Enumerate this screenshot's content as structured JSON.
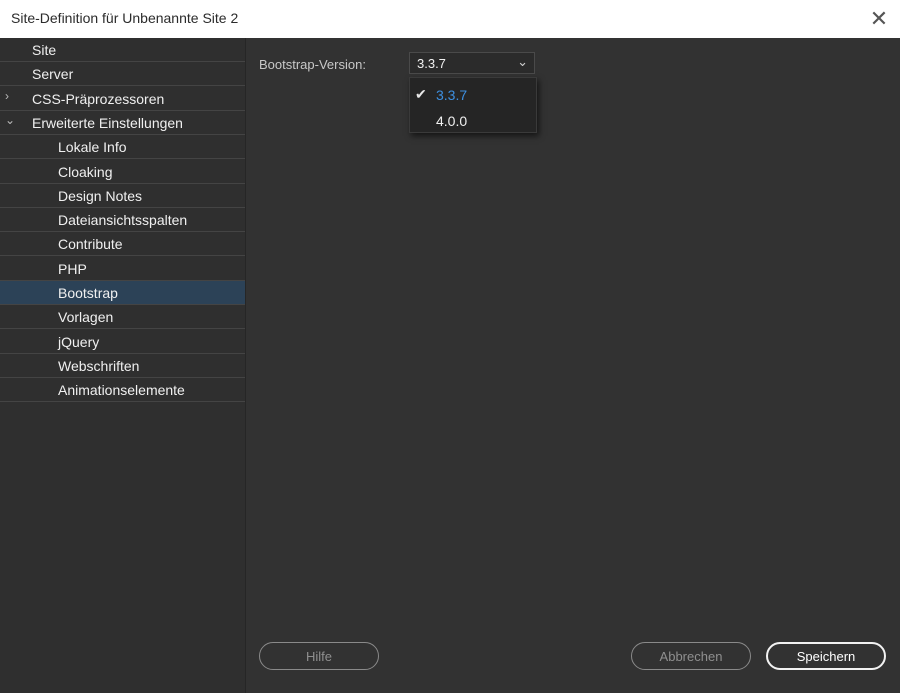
{
  "window": {
    "title": "Site-Definition für Unbenannte Site 2",
    "close_icon": "close-icon"
  },
  "sidebar": {
    "items": [
      {
        "label": "Site",
        "indent": 0,
        "chevron": ""
      },
      {
        "label": "Server",
        "indent": 0,
        "chevron": ""
      },
      {
        "label": "CSS-Präprozessoren",
        "indent": 0,
        "chevron": "›"
      },
      {
        "label": "Erweiterte Einstellungen",
        "indent": 0,
        "chevron": "⌄"
      },
      {
        "label": "Lokale Info",
        "indent": 1,
        "chevron": ""
      },
      {
        "label": "Cloaking",
        "indent": 1,
        "chevron": ""
      },
      {
        "label": "Design Notes",
        "indent": 1,
        "chevron": ""
      },
      {
        "label": "Dateiansichtsspalten",
        "indent": 1,
        "chevron": ""
      },
      {
        "label": "Contribute",
        "indent": 1,
        "chevron": ""
      },
      {
        "label": "PHP",
        "indent": 1,
        "chevron": ""
      },
      {
        "label": "Bootstrap",
        "indent": 1,
        "chevron": "",
        "selected": true
      },
      {
        "label": "Vorlagen",
        "indent": 1,
        "chevron": ""
      },
      {
        "label": "jQuery",
        "indent": 1,
        "chevron": ""
      },
      {
        "label": "Webschriften",
        "indent": 1,
        "chevron": ""
      },
      {
        "label": "Animationselemente",
        "indent": 1,
        "chevron": ""
      }
    ]
  },
  "main": {
    "bootstrap_version_label": "Bootstrap-Version:",
    "select": {
      "value": "3.3.7",
      "arrow_icon": "chevron-down-icon"
    },
    "dropdown": {
      "options": [
        {
          "label": "3.3.7",
          "checked": true
        },
        {
          "label": "4.0.0",
          "checked": false
        }
      ],
      "check_glyph": "✔"
    }
  },
  "footer": {
    "help_label": "Hilfe",
    "cancel_label": "Abbrechen",
    "save_label": "Speichern"
  },
  "colors": {
    "selected_bg": "#2c4257",
    "accent_blue": "#3d8fe0",
    "panel_bg": "#323232"
  }
}
